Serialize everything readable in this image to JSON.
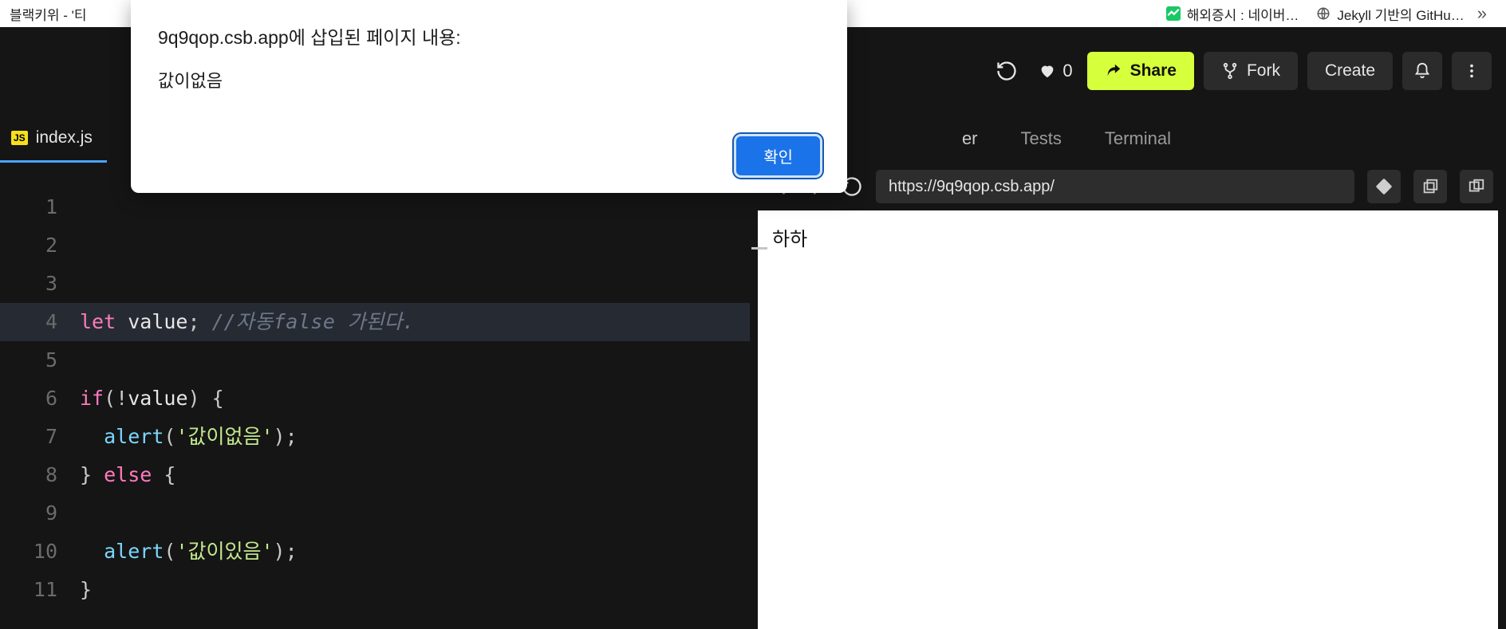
{
  "browser_tabs": {
    "left": {
      "label": "블랙키위 - '티"
    },
    "right1": {
      "label": "해외증시 : 네이버…"
    },
    "right2": {
      "label": "Jekyll 기반의 GitHu…"
    },
    "overflow": "»"
  },
  "alert": {
    "title": "9q9qop.csb.app에 삽입된 페이지 내용:",
    "message": "값이없음",
    "ok_label": "확인"
  },
  "topbar": {
    "likes": "0",
    "share": "Share",
    "fork": "Fork",
    "create": "Create"
  },
  "file_tab": {
    "badge": "JS",
    "name": "index.js"
  },
  "preview_tabs": {
    "partial": "er",
    "tests": "Tests",
    "terminal": "Terminal"
  },
  "preview": {
    "url": "https://9q9qop.csb.app/",
    "content": "하하"
  },
  "code_lines": [
    {
      "n": "1",
      "html": ""
    },
    {
      "n": "2",
      "html": ""
    },
    {
      "n": "3",
      "html": ""
    },
    {
      "n": "4",
      "html": "<span class='kw'>let</span> <span class='id'>value</span><span class='pn'>;</span> <span class='cmt'>//<span class='en'>자동false</span> 가된다.</span>",
      "hl": true
    },
    {
      "n": "5",
      "html": ""
    },
    {
      "n": "6",
      "html": "<span class='kw'>if</span><span class='pn'>(</span><span class='pn'>!</span><span class='id'>value</span><span class='pn'>)</span> <span class='pn'>{</span>"
    },
    {
      "n": "7",
      "html": "  <span class='fn'>alert</span><span class='pn'>(</span><span class='str'>'값이없음'</span><span class='pn'>);</span>"
    },
    {
      "n": "8",
      "html": "<span class='pn'>}</span> <span class='kw'>else</span> <span class='pn'>{</span>"
    },
    {
      "n": "9",
      "html": ""
    },
    {
      "n": "10",
      "html": "  <span class='fn'>alert</span><span class='pn'>(</span><span class='str'>'값이있음'</span><span class='pn'>);</span>"
    },
    {
      "n": "11",
      "html": "<span class='pn'>}</span>"
    }
  ]
}
